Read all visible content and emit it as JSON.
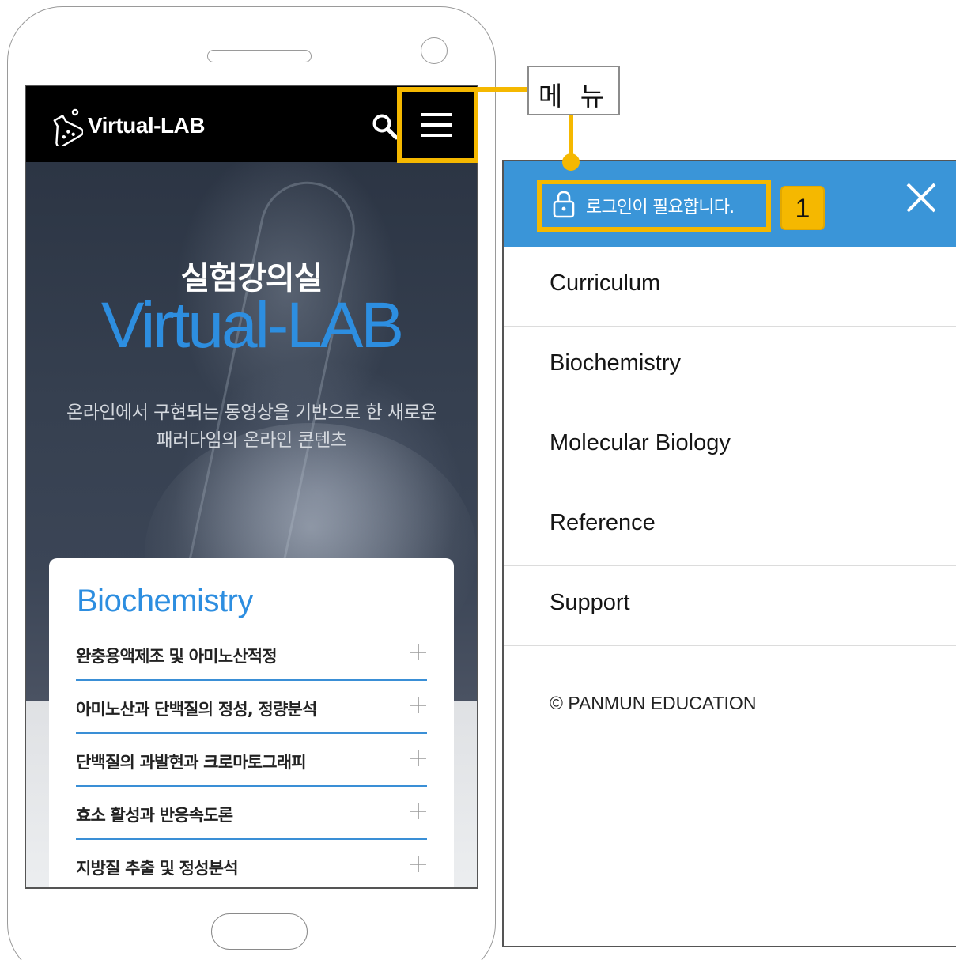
{
  "callout": {
    "label": "메 뉴",
    "badge": "1"
  },
  "app": {
    "brand": "Virtual-LAB",
    "hero_title": "실험강의실",
    "hero_brand": "Virtual-LAB",
    "hero_desc_line1": "온라인에서 구현되는 동영상을 기반으로 한 새로운",
    "hero_desc_line2": "패러다임의 온라인 콘텐츠"
  },
  "card": {
    "title": "Biochemistry",
    "items": [
      "완충용액제조 및 아미노산적정",
      "아미노산과 단백질의 정성, 정량분석",
      "단백질의 과발현과 크로마토그래피",
      "효소 활성과 반응속도론",
      "지방질 추출 및 정성분석"
    ]
  },
  "side_menu": {
    "login_text": "로그인이 필요합니다.",
    "items": [
      "Curriculum",
      "Biochemistry",
      "Molecular Biology",
      "Reference",
      "Support"
    ],
    "footer": "© PANMUN EDUCATION"
  },
  "colors": {
    "accent_blue": "#2d8ee0",
    "header_blue": "#3a95d8",
    "highlight": "#f5b800"
  },
  "icons": [
    "flask-icon",
    "search-icon",
    "hamburger-menu-icon",
    "lock-icon",
    "close-icon",
    "plus-icon"
  ]
}
